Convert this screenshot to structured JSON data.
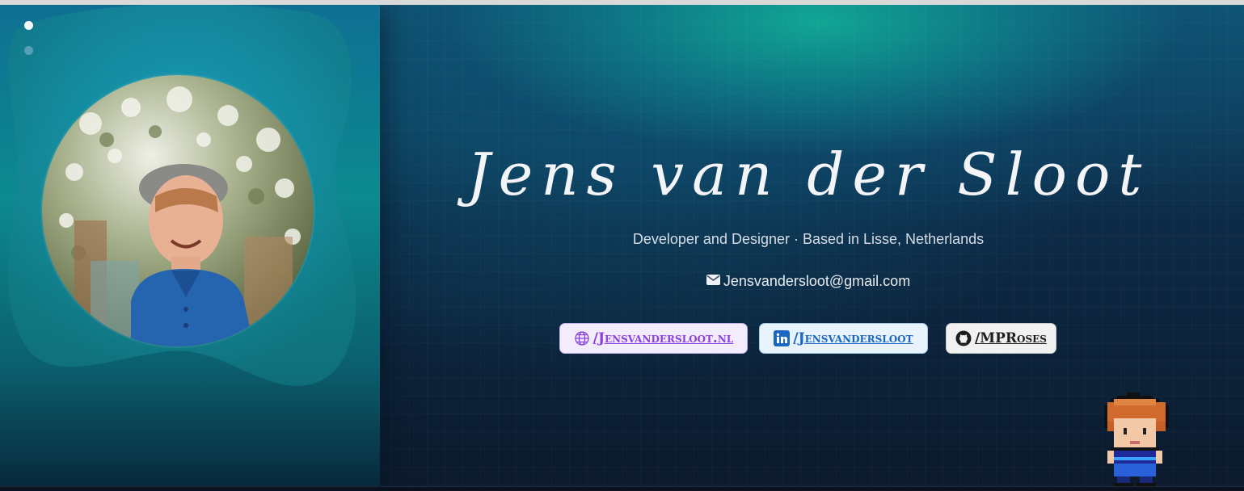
{
  "profile": {
    "name": "Jens van der Sloot",
    "subtitle": "Developer and Designer · Based in Lisse, Netherlands",
    "email": "Jensvandersloot@gmail.com"
  },
  "carousel": {
    "dots": 2,
    "active_index": 0
  },
  "links": [
    {
      "label": "/Jensvandersloot.nl",
      "icon": "globe-icon",
      "color": "#8a3fe0"
    },
    {
      "label": "/Jensvandersloot",
      "icon": "linkedin-icon",
      "color": "#1a66c2"
    },
    {
      "label": "/MPRoses",
      "icon": "github-icon",
      "color": "#1d1d1d"
    }
  ],
  "colors": {
    "accent_teal": "#10aa96",
    "background_dark": "#0c1a2c"
  }
}
